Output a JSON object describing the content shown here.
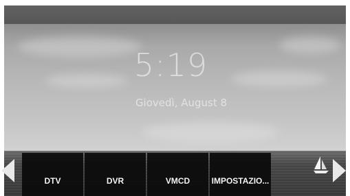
{
  "lock_screen": {
    "time": "5:19",
    "date": "Giovedì, August 8"
  },
  "menu": {
    "items": [
      {
        "label": "DTV"
      },
      {
        "label": "DVR"
      },
      {
        "label": "VMCD"
      },
      {
        "label": "IMPOSTAZIO..."
      }
    ]
  },
  "navigation": {
    "left_arrow_icon": "chevron-left-icon",
    "right_arrow_icon": "chevron-right-icon"
  },
  "colors": {
    "menu_background": "#0a0a0a",
    "menu_text": "#f2f2f2",
    "arrow": "#e9e9e9"
  }
}
